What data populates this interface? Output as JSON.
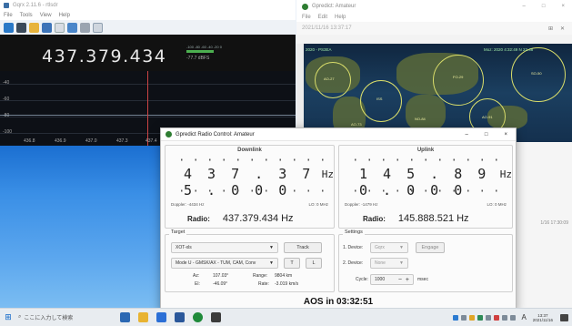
{
  "gqrx": {
    "title": "Gqrx 2.11.6 - rtlsdr",
    "menu": [
      "File",
      "Tools",
      "View",
      "Help"
    ],
    "toolbar_icons": [
      "play-icon",
      "device-icon",
      "folder-icon",
      "save-icon",
      "settings-icon",
      "screenshot-icon",
      "tools-icon",
      "fullscreen-icon"
    ],
    "frequency": "437.379.434",
    "smeter_scale": "-100  -80  -60  -40  -20  0",
    "smeter_value": "-77.7 dBFS",
    "plot_ylabels": [
      "-40",
      "-60",
      "-80",
      "-100"
    ],
    "plot_xlabels": [
      "436.8",
      "436.9",
      "437.0",
      "437.3",
      "437.4"
    ]
  },
  "gpredict": {
    "title": "Gpredict: Amateur",
    "menu": [
      "File",
      "Edit",
      "Help"
    ],
    "datetime": "2021/11/16 13:37:17",
    "map_labels": [
      "2020 - PS3EA",
      "Moz: 2020 4:32:49 N 22.48"
    ],
    "sat_labels": [
      "AO-27",
      "ISS",
      "FO-29",
      "SO-50",
      "AO-91",
      "NO-84",
      "AO-73"
    ],
    "lower_time": "1/16 17:30:09"
  },
  "radio": {
    "title": "Gpredict Radio Control: Amateur",
    "downlink": {
      "title": "Downlink",
      "digits": "437.375.000",
      "unit": "Hz",
      "doppler": "Doppler: -4434 Hz",
      "lo": "LO:  0 MHz",
      "label": "Radio:",
      "value": "437.379.434 Hz"
    },
    "uplink": {
      "title": "Uplink",
      "digits": "145.890.000",
      "unit": "Hz",
      "doppler": "Doppler: -1479 Hz",
      "lo": "LO:  0 MHz",
      "label": "Radio:",
      "value": "145.888.521 Hz"
    },
    "target": {
      "title": "Target",
      "satellite": "XOT-xls",
      "track_label": "Track",
      "mode": "Mode U - GMSK/AX - TUM, CAM, Conv",
      "t_label": "T",
      "l_label": "L",
      "az_label": "Az:",
      "az_value": "107.03°",
      "el_label": "El:",
      "el_value": "-46.09°",
      "range_label": "Range:",
      "range_value": "9804 km",
      "rate_label": "Rate:",
      "rate_value": "-3.019 km/s"
    },
    "settings": {
      "title": "Settings",
      "device1_label": "1. Device:",
      "device1_value": "Gqrx",
      "engage_label": "Engage",
      "device2_label": "2. Device:",
      "device2_value": "None",
      "cycle_label": "Cycle:",
      "cycle_value": "1000",
      "cycle_unit": "msec"
    },
    "aos": "AOS in 03:32:51"
  },
  "taskbar": {
    "search_placeholder": "ここに入力して検索",
    "ime": "A",
    "time": "13:37",
    "date": "2021/11/16"
  }
}
